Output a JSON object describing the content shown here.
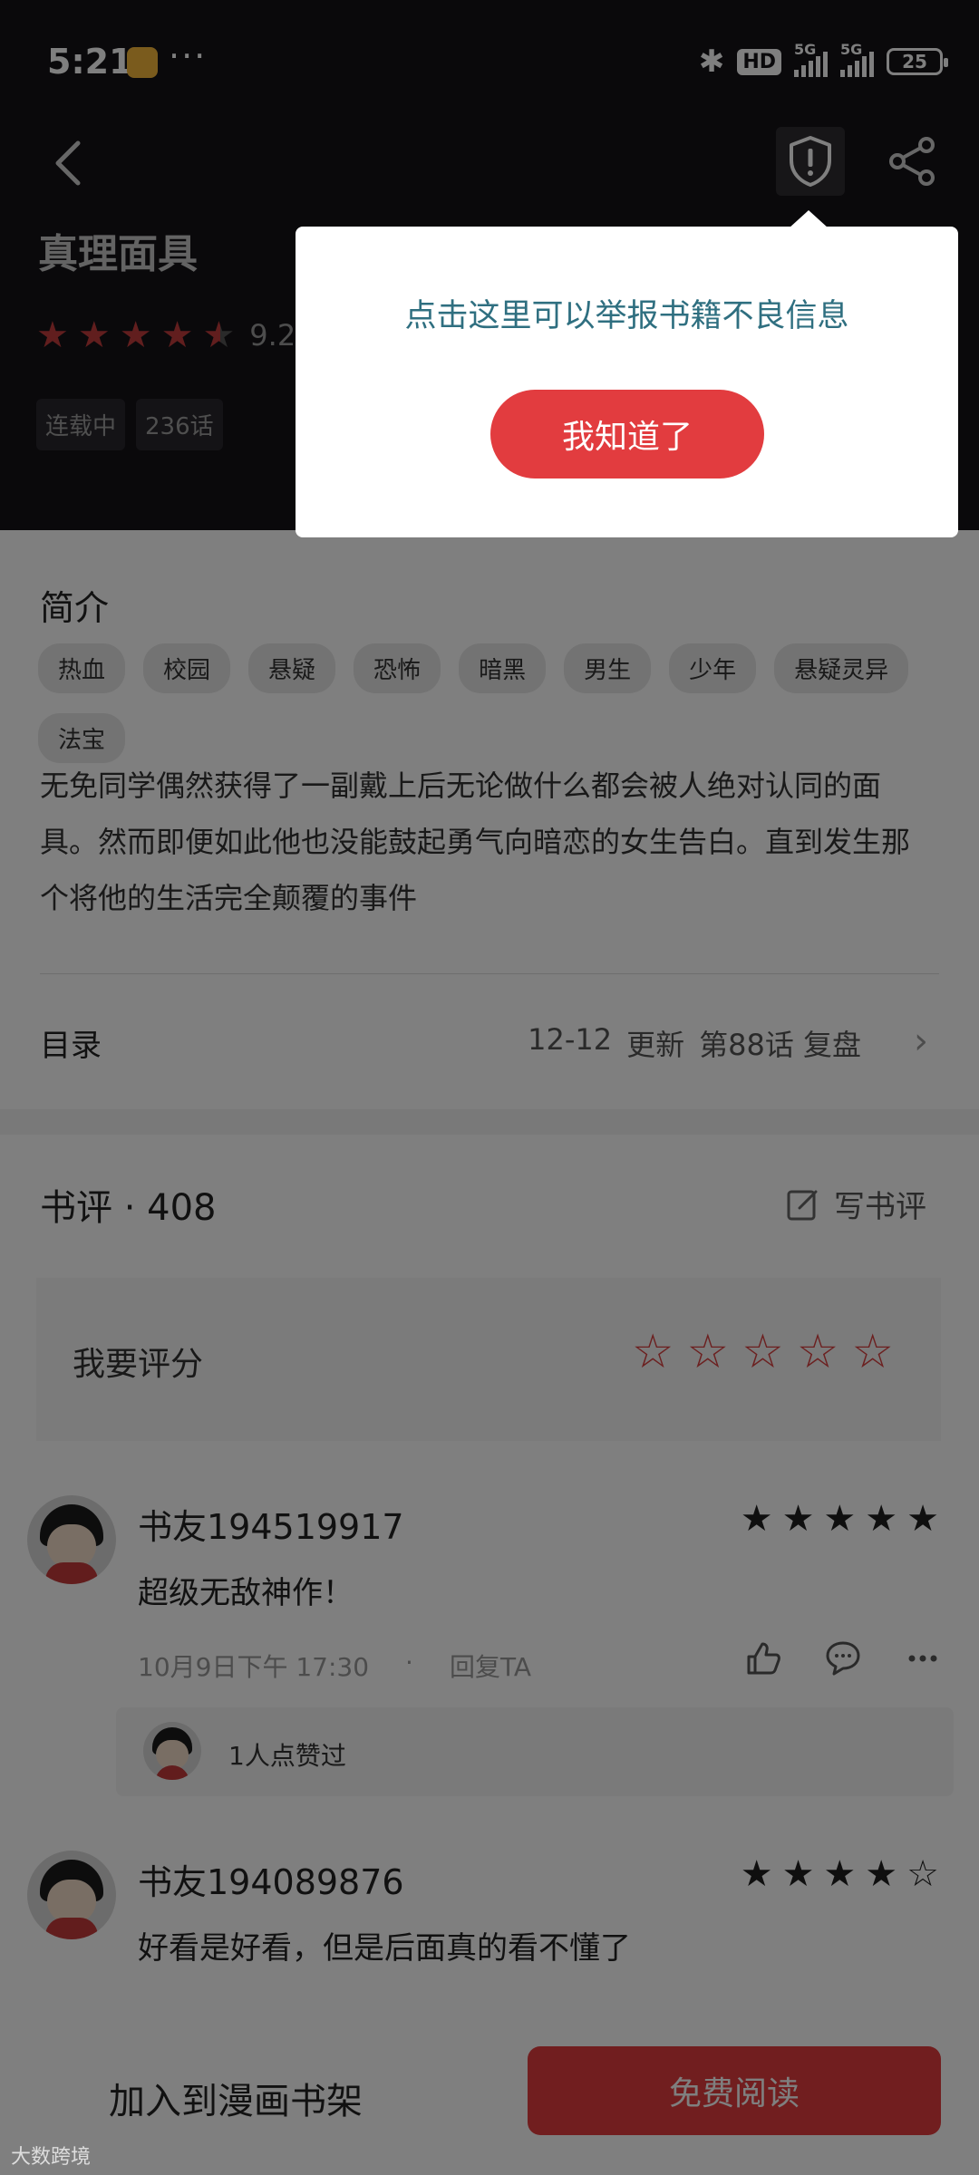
{
  "status_bar": {
    "time": "5:21",
    "dots": "···",
    "network_1": "5G",
    "network_2": "5G",
    "hd": "HD",
    "battery": "25"
  },
  "book": {
    "title": "真理面具",
    "score": "9.20",
    "status": "连载中",
    "episodes": "236话"
  },
  "popup": {
    "message": "点击这里可以举报书籍不良信息",
    "button": "我知道了"
  },
  "intro": {
    "heading": "简介",
    "tags": [
      "热血",
      "校园",
      "悬疑",
      "恐怖",
      "暗黑",
      "男生",
      "少年",
      "悬疑灵异",
      "法宝"
    ],
    "text": "无免同学偶然获得了一副戴上后无论做什么都会被人绝对认同的面具。然而即便如此他也没能鼓起勇气向暗恋的女生告白。直到发生那个将他的生活完全颠覆的事件"
  },
  "catalog": {
    "label": "目录",
    "date": "12-12",
    "update": "更新",
    "latest": "第88话 复盘"
  },
  "reviews_section": {
    "heading": "书评 · 408",
    "write": "写书评",
    "rate_label": "我要评分"
  },
  "reviews": [
    {
      "user": "书友194519917",
      "stars": 5,
      "text": "超级无敌神作！",
      "time": "10月9日下午 17:30",
      "reply": "回复TA",
      "likes": "1人点赞过"
    },
    {
      "user": "书友194089876",
      "stars": 4,
      "text": "好看是好看，但是后面真的看不懂了"
    }
  ],
  "bottom": {
    "add_shelf": "加入到漫画书架",
    "read": "免费阅读"
  },
  "watermark": "大数跨境"
}
